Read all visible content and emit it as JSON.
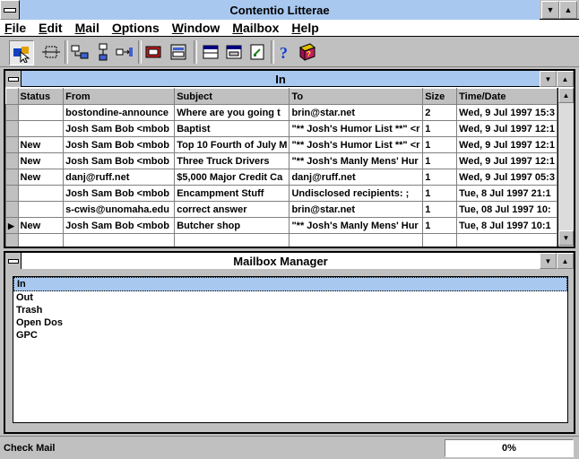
{
  "app": {
    "title": "Contentio Litterae"
  },
  "menu": [
    "File",
    "Edit",
    "Mail",
    "Options",
    "Window",
    "Mailbox",
    "Help"
  ],
  "menu_underline": [
    "F",
    "E",
    "M",
    "O",
    "W",
    "M",
    "H"
  ],
  "toolbar": {
    "icons": [
      "check-mail-icon",
      "select-icon",
      "forward-icon",
      "reply-icon",
      "redirect-icon",
      "print-icon",
      "address-book-icon",
      "window-icon",
      "window2-icon",
      "attach-icon",
      "help-icon",
      "book-icon"
    ]
  },
  "in_window": {
    "title": "In",
    "columns": [
      "Status",
      "From",
      "Subject",
      "To",
      "Size",
      "Time/Date"
    ],
    "rows": [
      {
        "status": "",
        "from": "bostondine-announce",
        "subject": "Where are you going t",
        "to": "brin@star.net",
        "size": "2",
        "date": "Wed, 9 Jul 1997 15:3"
      },
      {
        "status": "",
        "from": "Josh Sam Bob <mbob",
        "subject": " Baptist",
        "to": "\"** Josh's Humor List **\" <r",
        "size": "1",
        "date": "Wed, 9 Jul 1997 12:1"
      },
      {
        "status": "New",
        "from": "Josh Sam Bob <mbob",
        "subject": " Top 10 Fourth of July M",
        "to": "\"** Josh's Humor List **\" <r",
        "size": "1",
        "date": "Wed, 9 Jul 1997 12:1"
      },
      {
        "status": "New",
        "from": "Josh Sam Bob <mbob",
        "subject": " Three Truck Drivers",
        "to": "\"** Josh's Manly Mens' Hur",
        "size": "1",
        "date": "Wed, 9 Jul 1997 12:1"
      },
      {
        "status": "New",
        "from": "danj@ruff.net",
        "subject": "$5,000 Major Credit Ca",
        "to": "danj@ruff.net",
        "size": "1",
        "date": "Wed, 9 Jul 1997 05:3"
      },
      {
        "status": "",
        "from": "Josh Sam Bob <mbob",
        "subject": "Encampment Stuff",
        "to": "Undisclosed recipients: ;",
        "size": "1",
        "date": "Tue, 8 Jul 1997 21:1"
      },
      {
        "status": "",
        "from": "s-cwis@unomaha.edu",
        "subject": "correct answer",
        "to": "brin@star.net",
        "size": "1",
        "date": "Tue, 08 Jul 1997 10:"
      },
      {
        "status": "New",
        "from": "Josh Sam Bob <mbob",
        "subject": " Butcher shop",
        "to": "\"** Josh's Manly Mens' Hur",
        "size": "1",
        "date": "Tue, 8 Jul 1997 10:1",
        "current": true
      }
    ]
  },
  "mailbox_manager": {
    "title": "Mailbox Manager",
    "items": [
      "In",
      "Out",
      "Trash",
      "Open Dos",
      "GPC"
    ],
    "selected": "In"
  },
  "status": {
    "text": "Check Mail",
    "progress": "0%"
  },
  "colors": {
    "title_bar": "#a8c8f0",
    "face": "#c0c0c0"
  }
}
